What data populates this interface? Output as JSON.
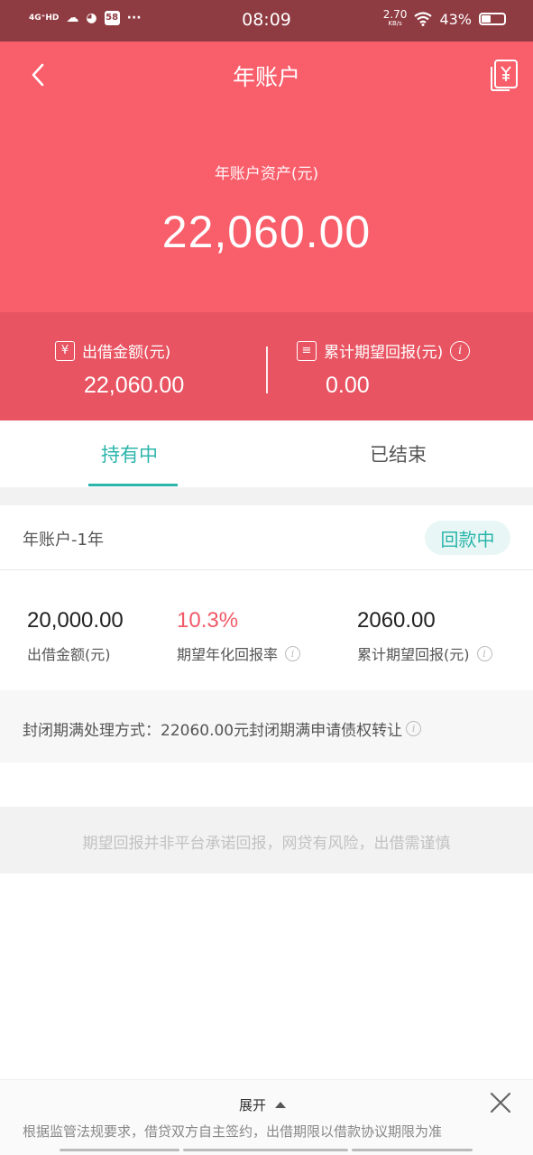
{
  "status_bar": {
    "network": "4G⁺HD",
    "time": "08:09",
    "app_badge": "58",
    "more": "···",
    "speed_value": "2.70",
    "speed_unit": "KB/s",
    "battery": "43%"
  },
  "nav": {
    "title": "年账户",
    "back_icon": "chevron-left-icon",
    "bill_icon": "yuan-bill-icon"
  },
  "hero": {
    "asset_label": "年账户资产(元)",
    "asset_value": "22,060.00"
  },
  "summary": {
    "lent": {
      "label": "出借金额(元)",
      "value": "22,060.00",
      "icon_glyph": "¥"
    },
    "expected": {
      "label": "累计期望回报(元)",
      "value": "0.00",
      "icon_glyph": "≡",
      "info_glyph": "i"
    }
  },
  "tabs": [
    {
      "label": "持有中",
      "active": true
    },
    {
      "label": "已结束",
      "active": false
    }
  ],
  "holding": {
    "title": "年账户-1年",
    "status": "回款中",
    "metrics": [
      {
        "value": "20,000.00",
        "label": "出借金额(元)",
        "has_info": false
      },
      {
        "value": "10.3%",
        "label": "期望年化回报率",
        "has_info": true
      },
      {
        "value": "2060.00",
        "label": "累计期望回报(元)",
        "has_info": true
      }
    ],
    "closing_text": "封闭期满处理方式：22060.00元封闭期满申请债权转让"
  },
  "disclaimer": "期望回报并非平台承诺回报，网贷有风险，出借需谨慎",
  "bottom": {
    "expand_label": "展开",
    "notice": "根据监管法规要求，借贷双方自主签约，出借期限以借款协议期限为准"
  },
  "colors": {
    "hero": "#f95e6b",
    "summary": "#e85462",
    "accent": "#2bb5ab",
    "rate": "#f05a68",
    "status_bar": "#8f3b42"
  }
}
